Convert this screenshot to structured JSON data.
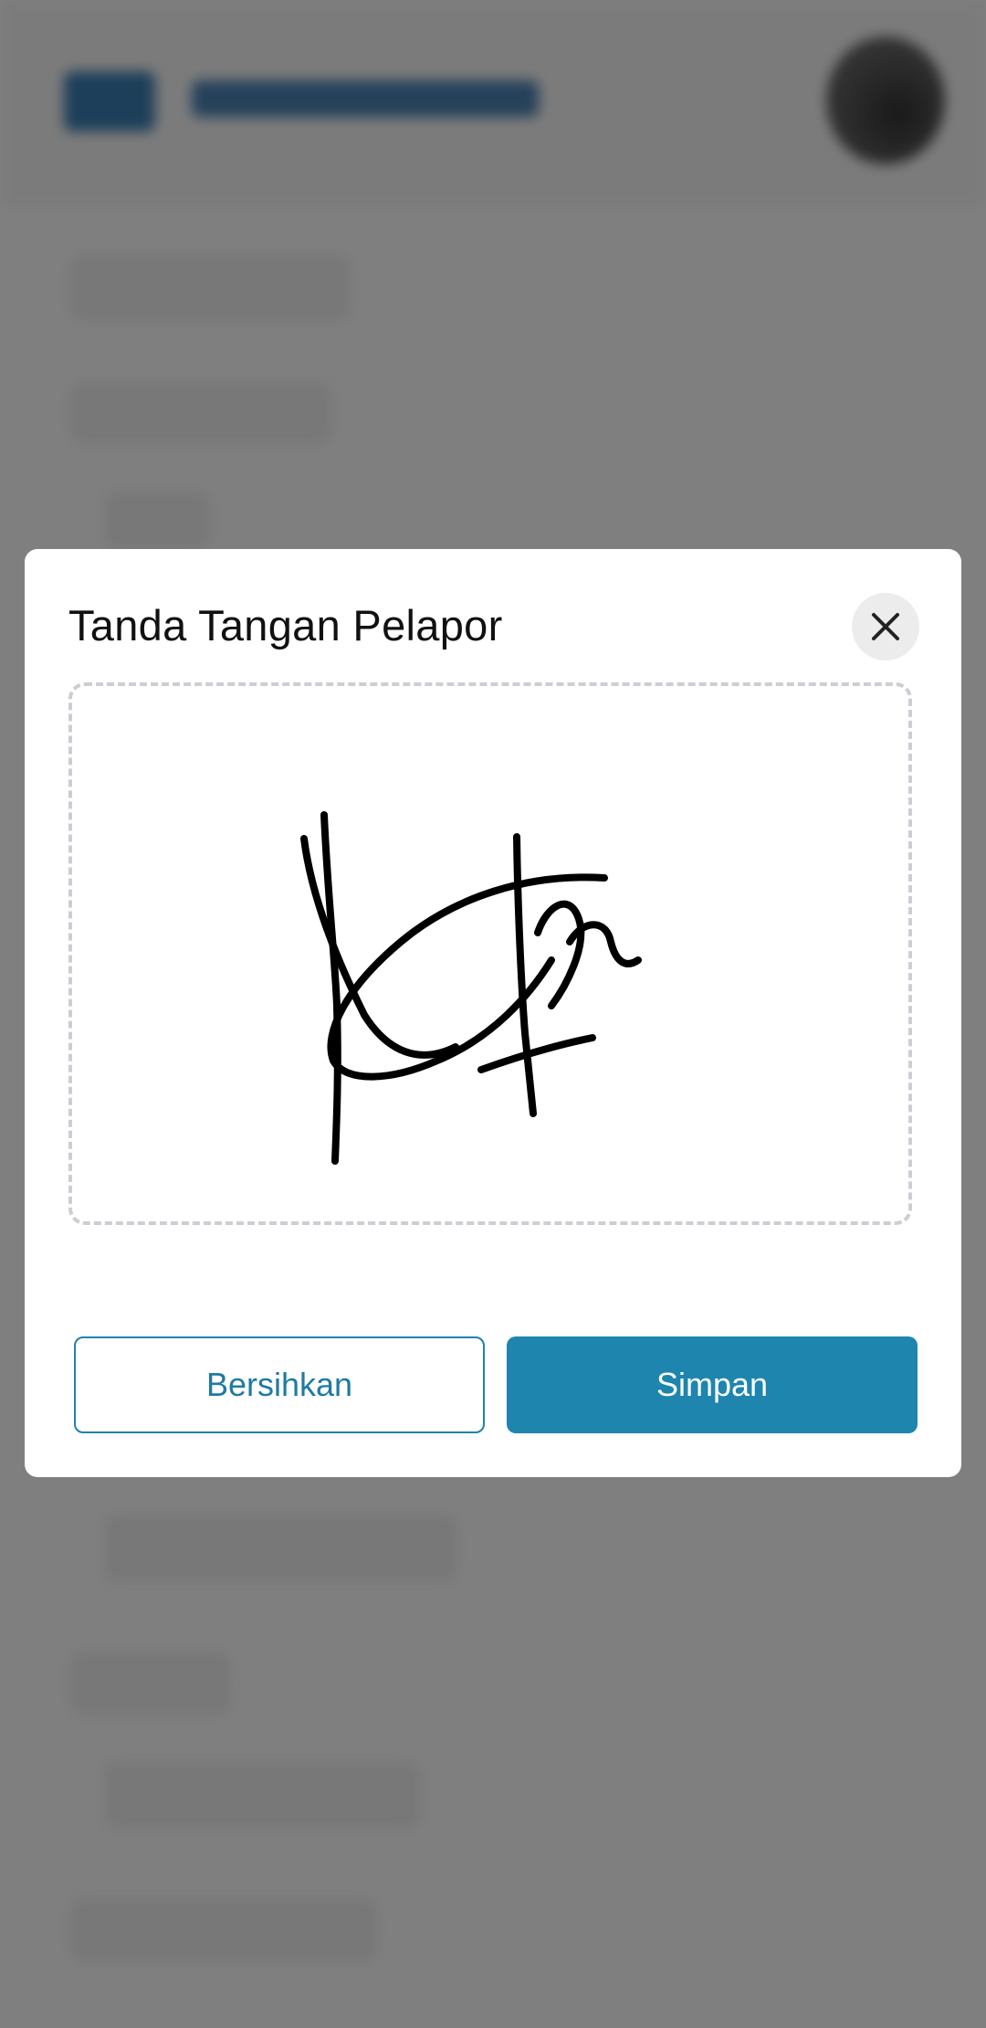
{
  "modal": {
    "title": "Tanda Tangan Pelapor",
    "close_icon": "close-icon",
    "clear_label": "Bersihkan",
    "save_label": "Simpan"
  },
  "colors": {
    "primary": "#1e85ae",
    "overlay": "rgba(0,0,0,0.5)",
    "signature_stroke": "#000000"
  }
}
